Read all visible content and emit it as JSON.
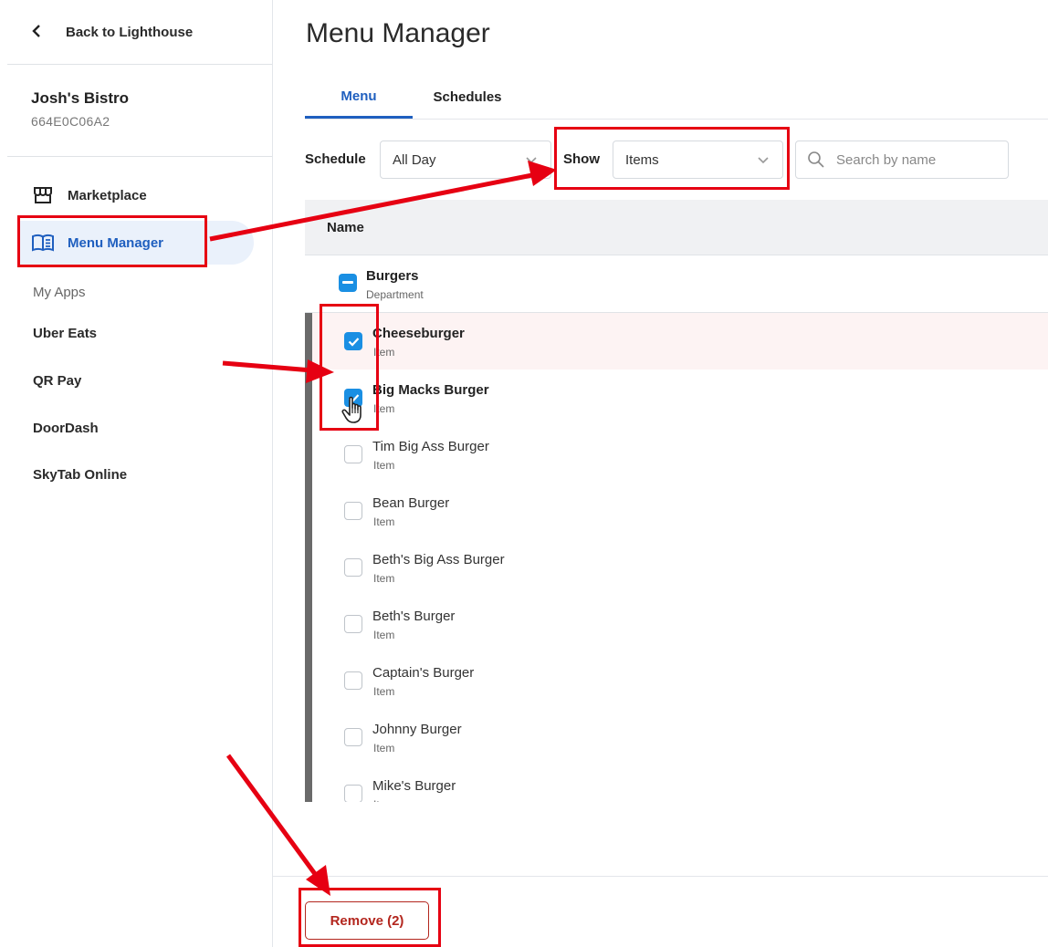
{
  "sidebar": {
    "back_label": "Back to Lighthouse",
    "business_name": "Josh's Bistro",
    "business_id": "664E0C06A2",
    "nav": {
      "marketplace": "Marketplace",
      "menu_manager": "Menu Manager"
    },
    "apps_heading": "My Apps",
    "apps": [
      "Uber Eats",
      "QR Pay",
      "DoorDash",
      "SkyTab Online"
    ]
  },
  "main": {
    "title": "Menu Manager",
    "tabs": [
      {
        "label": "Menu",
        "active": true
      },
      {
        "label": "Schedules",
        "active": false
      }
    ],
    "filters": {
      "schedule_label": "Schedule",
      "schedule_value": "All Day",
      "show_label": "Show",
      "show_value": "Items",
      "search_placeholder": "Search by name"
    },
    "table": {
      "header_name": "Name",
      "department": {
        "name": "Burgers",
        "type": "Department",
        "state": "indeterminate"
      },
      "items": [
        {
          "name": "Cheeseburger",
          "type": "Item",
          "checked": true
        },
        {
          "name": "Big Macks Burger",
          "type": "Item",
          "checked": true
        },
        {
          "name": "Tim Big Ass Burger",
          "type": "Item",
          "checked": false
        },
        {
          "name": "Bean Burger",
          "type": "Item",
          "checked": false
        },
        {
          "name": "Beth's Big Ass Burger",
          "type": "Item",
          "checked": false
        },
        {
          "name": "Beth's Burger",
          "type": "Item",
          "checked": false
        },
        {
          "name": "Captain's Burger",
          "type": "Item",
          "checked": false
        },
        {
          "name": "Johnny Burger",
          "type": "Item",
          "checked": false
        },
        {
          "name": "Mike's Burger",
          "type": "Item",
          "checked": false
        }
      ]
    },
    "remove_label": "Remove (2)"
  },
  "colors": {
    "accent": "#1f5fbf",
    "checkbox": "#1a8fe3",
    "danger": "#b3261e",
    "annotation": "#e60012"
  }
}
